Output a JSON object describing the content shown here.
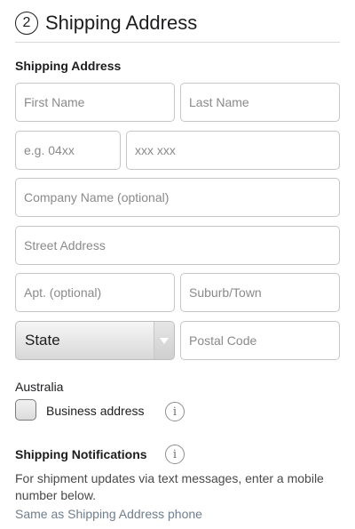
{
  "header": {
    "step_number": "2",
    "title": "Shipping Address"
  },
  "section": {
    "title": "Shipping Address"
  },
  "fields": {
    "first_name": {
      "placeholder": "First Name"
    },
    "last_name": {
      "placeholder": "Last Name"
    },
    "area_code": {
      "placeholder": "e.g. 04xx"
    },
    "phone_number": {
      "placeholder": "xxx xxx"
    },
    "company_name": {
      "placeholder": "Company Name (optional)"
    },
    "street_address": {
      "placeholder": "Street Address"
    },
    "apartment": {
      "placeholder": "Apt. (optional)"
    },
    "suburb_town": {
      "placeholder": "Suburb/Town"
    },
    "state": {
      "selected": "State"
    },
    "postal_code": {
      "placeholder": "Postal Code"
    }
  },
  "country": "Australia",
  "business": {
    "label": "Business address",
    "checked": false,
    "info_icon": "info-icon"
  },
  "notifications": {
    "title": "Shipping Notifications",
    "info_icon": "info-icon",
    "description": "For shipment updates via text messages, enter a mobile number below.",
    "same_as_link": "Same as Shipping Address phone"
  },
  "colors": {
    "text": "#1d1d1f",
    "placeholder": "#8a8a8a",
    "border": "#c6c6c6",
    "link": "#6f7f8e"
  }
}
